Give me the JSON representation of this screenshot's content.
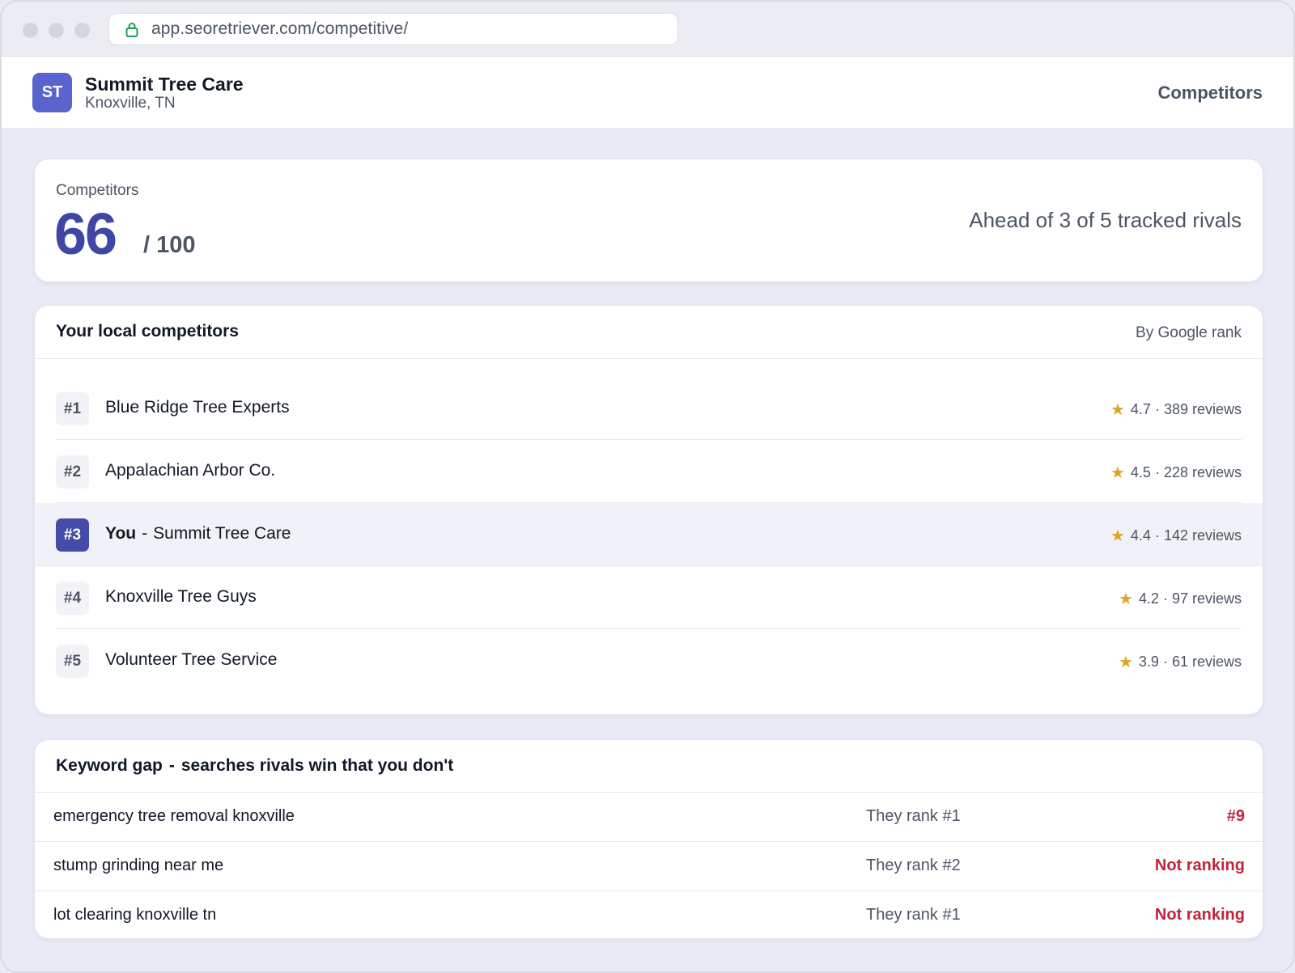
{
  "browser": {
    "url": "app.seoretriever.com/competitive/"
  },
  "header": {
    "avatar_initials": "ST",
    "business_name": "Summit Tree Care",
    "location": "Knoxville, TN",
    "nav_title": "Competitors"
  },
  "score": {
    "label": "Competitors",
    "value": "66",
    "max": "/ 100",
    "summary": "Ahead of 3 of 5 tracked rivals"
  },
  "competitors": {
    "title": "Your local competitors",
    "sort_label": "By Google rank",
    "rows": [
      {
        "rank": "#1",
        "name": "Blue Ridge Tree Experts",
        "rating": "4.7",
        "reviews": "389 reviews"
      },
      {
        "rank": "#2",
        "name": "Appalachian Arbor Co.",
        "rating": "4.5",
        "reviews": "228 reviews"
      },
      {
        "rank": "#3",
        "you_label": "You",
        "dash": "-",
        "name": "Summit Tree Care",
        "rating": "4.4",
        "reviews": "142 reviews"
      },
      {
        "rank": "#4",
        "name": "Knoxville Tree Guys",
        "rating": "4.2",
        "reviews": "97 reviews"
      },
      {
        "rank": "#5",
        "name": "Volunteer Tree Service",
        "rating": "3.9",
        "reviews": "61 reviews"
      }
    ],
    "separator": "·",
    "star_glyph": "★"
  },
  "keyword_gap": {
    "title_main": "Keyword gap",
    "title_dash": "-",
    "title_sub": "searches rivals win that you don't",
    "rows": [
      {
        "keyword": "emergency tree removal knoxville",
        "them": "They rank #1",
        "you": "#9"
      },
      {
        "keyword": "stump grinding near me",
        "them": "They rank #2",
        "you": "Not ranking"
      },
      {
        "keyword": "lot clearing knoxville tn",
        "them": "They rank #1",
        "you": "Not ranking"
      }
    ]
  },
  "colors": {
    "accent": "#444ca8",
    "avatar": "#5b63cf",
    "star": "#e0a325",
    "negative": "#c0243a",
    "background": "#e8ebf6"
  },
  "icons": {
    "lock": "lock-icon",
    "star": "star-icon"
  }
}
